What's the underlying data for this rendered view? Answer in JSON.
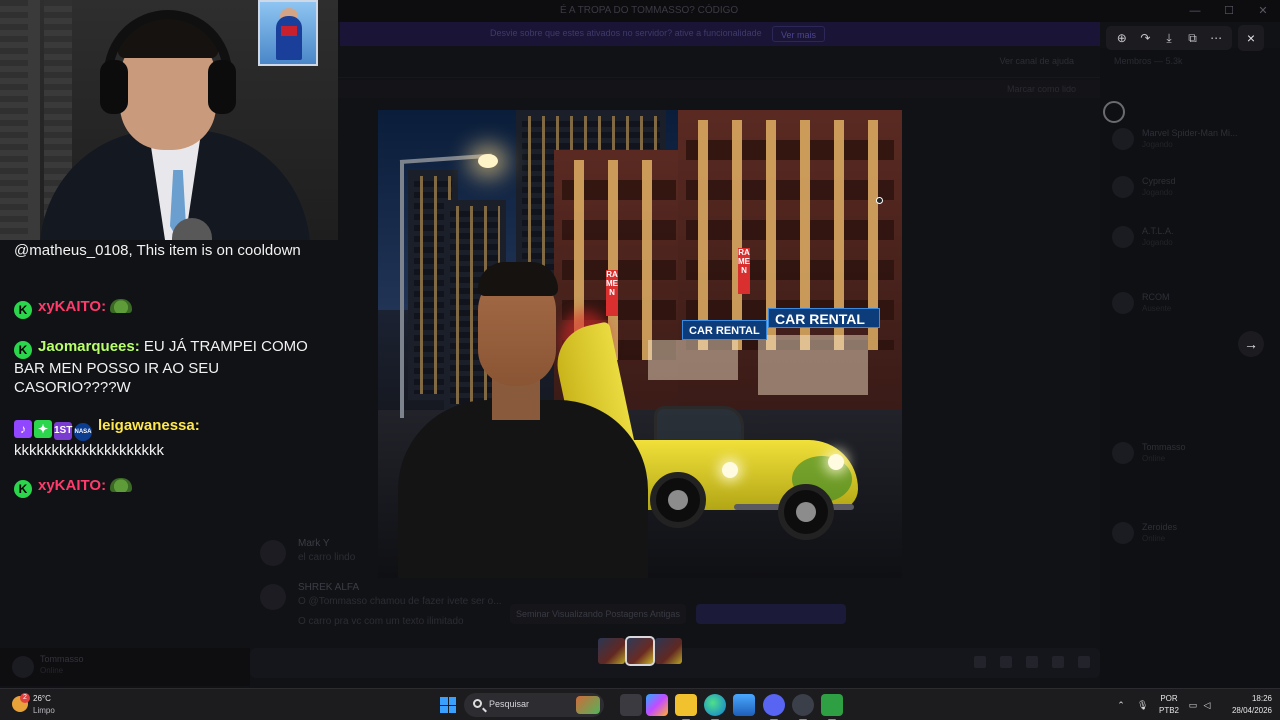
{
  "background_app": {
    "window_title": "É A TROPA DO TOMMASSO? CÓDIGO",
    "banner_text": "Desvie sobre que estes ativados no servidor? ative a funcionalidade",
    "banner_button": "Ver mais",
    "header_right": "Ver canal de ajuda",
    "subheader_right": "Marcar como lido",
    "member_panel_title": "Membros — 5.3k",
    "members": [
      {
        "name": "Marvel Spider-Man Mi...",
        "status": "Jogando"
      },
      {
        "name": "Cypresd",
        "status": "Jogando"
      },
      {
        "name": "A.T.L.A.",
        "status": "Jogando"
      },
      {
        "name": "RCOM",
        "status": "Ausente"
      },
      {
        "name": "Tommasso",
        "status": "Online"
      },
      {
        "name": "Zeroides",
        "status": "Online"
      }
    ],
    "messages": [
      {
        "author": "Mark Y",
        "text": "el carro lindo"
      },
      {
        "author": "SHREK ALFA",
        "text": "O @Tommasso chamou de fazer ivete ser o..."
      },
      {
        "author": "",
        "text": "O carro pra vc com um texto ilimitado"
      }
    ],
    "typing_text": "Seminar Visualizando Postagens Antigas",
    "user_panel": {
      "name": "Tommasso",
      "status": "Online"
    }
  },
  "viewer": {
    "toolbar_icons": [
      "zoom-in-icon",
      "forward-icon",
      "download-icon",
      "open-external-icon",
      "more-icon"
    ],
    "close_icon": "×",
    "next_icon": "→",
    "thumbnail_count": 3,
    "active_thumbnail": 2
  },
  "image": {
    "signs": [
      "CAR RENTAL",
      "CAR RENTAL",
      "RAMEN",
      "RAMEN"
    ]
  },
  "chat": {
    "messages": [
      {
        "type": "system",
        "text": "@matheus_0108, This item is on cooldown"
      },
      {
        "type": "user",
        "badges": [
          "k"
        ],
        "user": "xyKAITO:",
        "user_color": "#ff3b6b",
        "text": "",
        "emote": "turtle"
      },
      {
        "type": "user",
        "badges": [
          "k"
        ],
        "user": "Jaomarquees:",
        "user_color": "#b9ff6a",
        "text": "EU JÁ TRAMPEI COMO BAR MEN POSSO IR AO SEU CASORIO????W"
      },
      {
        "type": "user",
        "badges": [
          "tw",
          "sw",
          "one",
          "nasa"
        ],
        "user": "leigawanessa:",
        "user_color": "#ffe84d",
        "text": "kkkkkkkkkkkkkkkkkkkk"
      },
      {
        "type": "user",
        "badges": [
          "k"
        ],
        "user": "xyKAITO:",
        "user_color": "#ff3b6b",
        "text": "",
        "emote": "turtle"
      }
    ],
    "badge_labels": {
      "k": "K",
      "tw": "♪",
      "sw": "✦",
      "one": "1ST",
      "nasa": "NASA"
    }
  },
  "taskbar": {
    "weather_temp": "26°C",
    "weather_condition": "Limpo",
    "weather_badge": "2",
    "search_placeholder": "Pesquisar",
    "language_top": "POR",
    "language_bottom": "PTB2",
    "time": "18:26",
    "date": "28/04/2026",
    "apps": [
      "start",
      "search",
      "widgets",
      "task-view",
      "copilot",
      "file-explorer",
      "edge",
      "photos",
      "discord",
      "steam",
      "xbox"
    ]
  },
  "colors": {
    "accent": "#5865f2",
    "chat_k_badge": "#2bd64c",
    "twitch_purple": "#9146ff"
  }
}
